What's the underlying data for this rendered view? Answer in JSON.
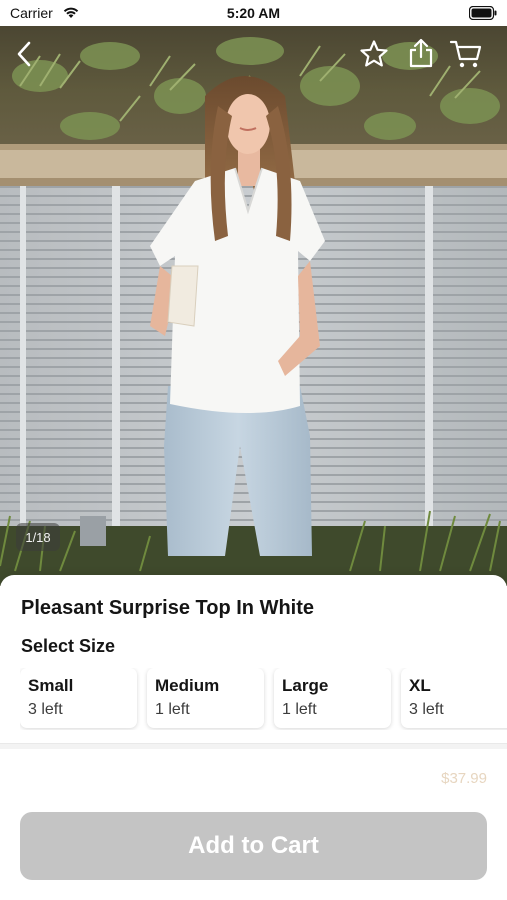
{
  "status_bar": {
    "carrier": "Carrier",
    "time": "5:20 AM"
  },
  "hero": {
    "icons": {
      "back": "chevron-left-icon",
      "favorite": "star-icon",
      "share": "share-icon",
      "cart": "cart-icon"
    },
    "counter": "1/18"
  },
  "product": {
    "title": "Pleasant Surprise Top In White",
    "select_size_label": "Select Size",
    "sizes": [
      {
        "name": "Small",
        "stock": "3 left"
      },
      {
        "name": "Medium",
        "stock": "1 left"
      },
      {
        "name": "Large",
        "stock": "1 left"
      },
      {
        "name": "XL",
        "stock": "3 left"
      }
    ],
    "price": "$37.99"
  },
  "actions": {
    "add_to_cart": "Add to Cart"
  },
  "colors": {
    "button_disabled": "#c4c4c4",
    "price": "#e7d6c0"
  }
}
